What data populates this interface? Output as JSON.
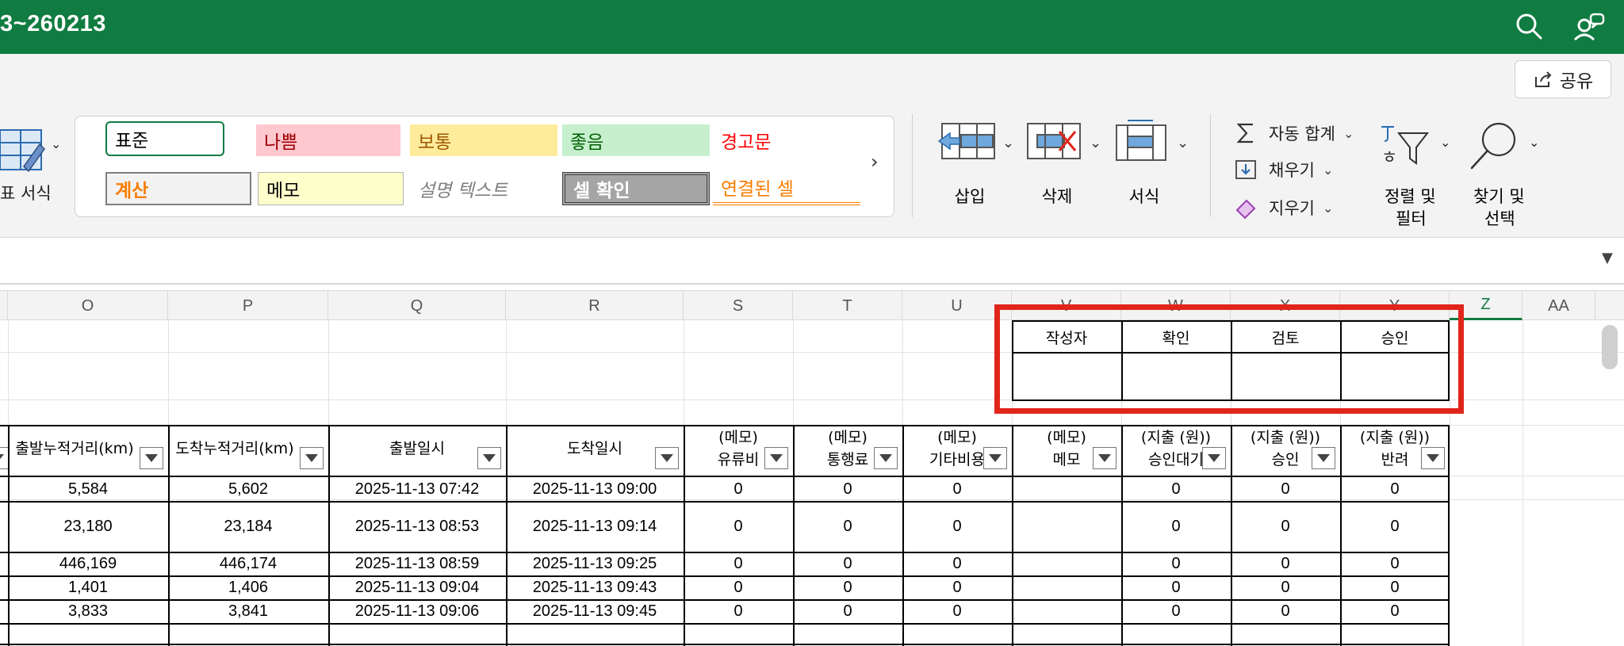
{
  "title": "3~260213",
  "share_label": "공유",
  "styles": {
    "row1": [
      {
        "label": "표준",
        "bg": "#ffffff",
        "color": "#000000"
      },
      {
        "label": "나쁨",
        "bg": "#ffc7ce",
        "color": "#9c0006"
      },
      {
        "label": "보통",
        "bg": "#ffeb9c",
        "color": "#9c5700"
      },
      {
        "label": "좋음",
        "bg": "#c6efce",
        "color": "#006100"
      },
      {
        "label": "경고문",
        "bg": "#ffffff",
        "color": "#ff0000"
      }
    ],
    "row2": [
      {
        "label": "계산",
        "bg": "#f2f2f2",
        "color": "#fa7d00"
      },
      {
        "label": "메모",
        "bg": "#ffffcc",
        "color": "#000000"
      },
      {
        "label": "설명 텍스트",
        "bg": "#ffffff",
        "color": "#7f7f7f"
      },
      {
        "label": "셀 확인",
        "bg": "#a5a5a5",
        "color": "#ffffff"
      },
      {
        "label": "연결된 셀",
        "bg": "#ffffff",
        "color": "#fa7d00"
      }
    ]
  },
  "ribbon": {
    "format_table_label": "표 서식",
    "insert_label": "삽입",
    "delete_label": "삭제",
    "format_label": "서식",
    "autosum_label": "자동 합계",
    "fill_label": "채우기",
    "clear_label": "지우기",
    "sort_filter_label_1": "정렬 및",
    "sort_filter_label_2": "필터",
    "find_select_label_1": "찾기 및",
    "find_select_label_2": "선택"
  },
  "columns": [
    "O",
    "P",
    "Q",
    "R",
    "S",
    "T",
    "U",
    "V",
    "W",
    "X",
    "Y",
    "Z",
    "AA"
  ],
  "approval": {
    "headers": [
      "작성자",
      "확인",
      "검토",
      "승인"
    ]
  },
  "table_headers": [
    [
      "출발누적거리(km)",
      ""
    ],
    [
      "도착누적거리(km)",
      ""
    ],
    [
      "출발일시",
      ""
    ],
    [
      "도착일시",
      ""
    ],
    [
      "(메모)",
      "유류비"
    ],
    [
      "(메모)",
      "통행료"
    ],
    [
      "(메모)",
      "기타비용"
    ],
    [
      "(메모)",
      "메모"
    ],
    [
      "(지출 (원))",
      "승인대기"
    ],
    [
      "(지출 (원))",
      "승인"
    ],
    [
      "(지출 (원))",
      "반려"
    ]
  ],
  "rows": [
    [
      "5,584",
      "5,602",
      "2025-11-13 07:42",
      "2025-11-13 09:00",
      "0",
      "0",
      "0",
      "",
      "0",
      "0",
      "0"
    ],
    [
      "23,180",
      "23,184",
      "2025-11-13 08:53",
      "2025-11-13 09:14",
      "0",
      "0",
      "0",
      "",
      "0",
      "0",
      "0"
    ],
    [
      "446,169",
      "446,174",
      "2025-11-13 08:59",
      "2025-11-13 09:25",
      "0",
      "0",
      "0",
      "",
      "0",
      "0",
      "0"
    ],
    [
      "1,401",
      "1,406",
      "2025-11-13 09:04",
      "2025-11-13 09:43",
      "0",
      "0",
      "0",
      "",
      "0",
      "0",
      "0"
    ],
    [
      "3,833",
      "3,841",
      "2025-11-13 09:06",
      "2025-11-13 09:45",
      "0",
      "0",
      "0",
      "",
      "0",
      "0",
      "0"
    ]
  ],
  "colors": {
    "title_bar": "#107c41",
    "highlight_box": "#e0261b"
  }
}
